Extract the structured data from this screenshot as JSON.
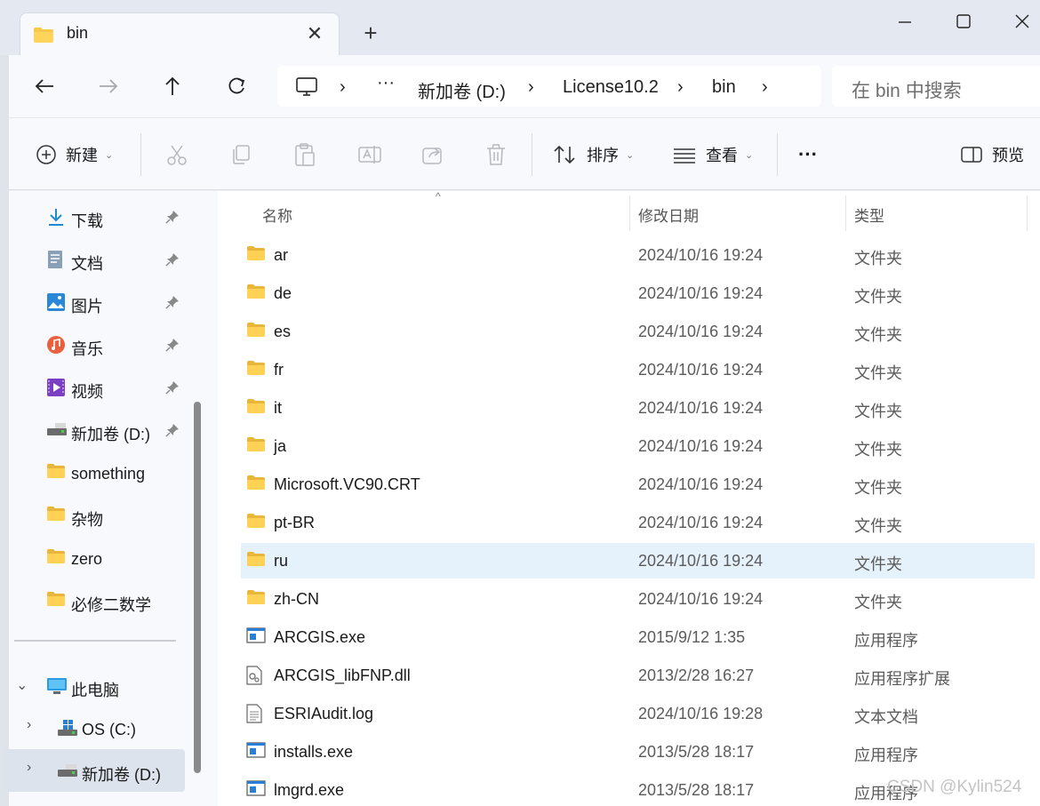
{
  "window": {
    "tab_title": "bin",
    "new_tab_label": "+",
    "tab_close_label": "✕"
  },
  "nav": {
    "breadcrumb": [
      "新加卷 (D:)",
      "License10.2",
      "bin"
    ],
    "breadcrumb_overflow": "···",
    "search_placeholder": "在 bin 中搜索"
  },
  "toolbar": {
    "new_label": "新建",
    "sort_label": "排序",
    "view_label": "查看",
    "more_label": "···",
    "preview_label": "预览"
  },
  "sidebar": {
    "quick_access": [
      {
        "label": "下载",
        "icon": "download-icon",
        "pinned": true
      },
      {
        "label": "文档",
        "icon": "document-icon",
        "pinned": true
      },
      {
        "label": "图片",
        "icon": "pictures-icon",
        "pinned": true
      },
      {
        "label": "音乐",
        "icon": "music-icon",
        "pinned": true
      },
      {
        "label": "视频",
        "icon": "video-icon",
        "pinned": true
      },
      {
        "label": "新加卷 (D:)",
        "icon": "drive-icon",
        "pinned": true
      },
      {
        "label": "something",
        "icon": "folder-icon",
        "pinned": false
      },
      {
        "label": "杂物",
        "icon": "folder-icon",
        "pinned": false
      },
      {
        "label": "zero",
        "icon": "folder-icon",
        "pinned": false
      },
      {
        "label": "必修二数学",
        "icon": "folder-icon",
        "pinned": false
      }
    ],
    "this_pc_label": "此电脑",
    "drives": [
      {
        "label": "OS (C:)",
        "icon": "windows-drive-icon"
      },
      {
        "label": "新加卷 (D:)",
        "icon": "drive-icon",
        "selected": true
      }
    ]
  },
  "filelist": {
    "columns": {
      "name": "名称",
      "date": "修改日期",
      "type": "类型"
    },
    "rows": [
      {
        "name": "ar",
        "date": "2024/10/16 19:24",
        "type": "文件夹",
        "icon": "folder-icon"
      },
      {
        "name": "de",
        "date": "2024/10/16 19:24",
        "type": "文件夹",
        "icon": "folder-icon"
      },
      {
        "name": "es",
        "date": "2024/10/16 19:24",
        "type": "文件夹",
        "icon": "folder-icon"
      },
      {
        "name": "fr",
        "date": "2024/10/16 19:24",
        "type": "文件夹",
        "icon": "folder-icon"
      },
      {
        "name": "it",
        "date": "2024/10/16 19:24",
        "type": "文件夹",
        "icon": "folder-icon"
      },
      {
        "name": "ja",
        "date": "2024/10/16 19:24",
        "type": "文件夹",
        "icon": "folder-icon"
      },
      {
        "name": "Microsoft.VC90.CRT",
        "date": "2024/10/16 19:24",
        "type": "文件夹",
        "icon": "folder-icon"
      },
      {
        "name": "pt-BR",
        "date": "2024/10/16 19:24",
        "type": "文件夹",
        "icon": "folder-icon"
      },
      {
        "name": "ru",
        "date": "2024/10/16 19:24",
        "type": "文件夹",
        "icon": "folder-icon",
        "selected": true
      },
      {
        "name": "zh-CN",
        "date": "2024/10/16 19:24",
        "type": "文件夹",
        "icon": "folder-icon"
      },
      {
        "name": "ARCGIS.exe",
        "date": "2015/9/12 1:35",
        "type": "应用程序",
        "icon": "exe-icon"
      },
      {
        "name": "ARCGIS_libFNP.dll",
        "date": "2013/2/28 16:27",
        "type": "应用程序扩展",
        "icon": "dll-icon"
      },
      {
        "name": "ESRIAudit.log",
        "date": "2024/10/16 19:28",
        "type": "文本文档",
        "icon": "text-file-icon"
      },
      {
        "name": "installs.exe",
        "date": "2013/5/28 18:17",
        "type": "应用程序",
        "icon": "exe-icon"
      },
      {
        "name": "lmgrd.exe",
        "date": "2013/5/28 18:17",
        "type": "应用程序",
        "icon": "exe-icon"
      }
    ]
  },
  "watermark": "CSDN @Kylin524",
  "colors": {
    "accent": "#0067c0",
    "folder": "#f7c948",
    "selection": "#e5f1fb"
  }
}
